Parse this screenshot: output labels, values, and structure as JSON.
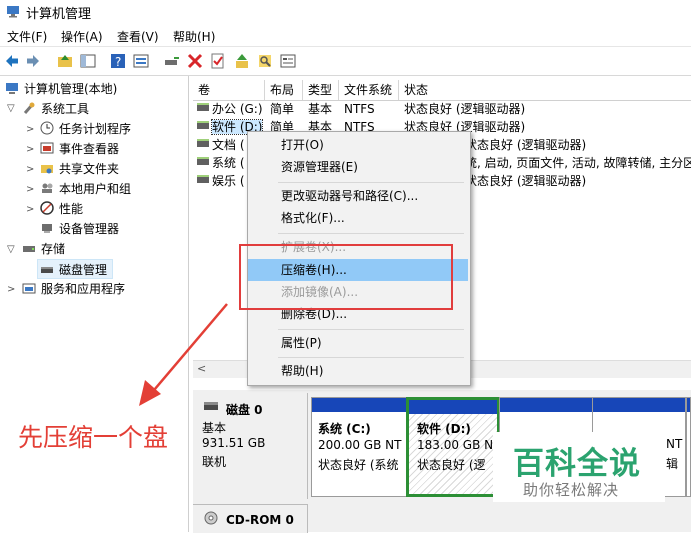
{
  "window": {
    "title": "计算机管理"
  },
  "menu": [
    "文件(F)",
    "操作(A)",
    "查看(V)",
    "帮助(H)"
  ],
  "toolbar": {
    "icons": [
      "back-arrow-icon",
      "forward-arrow-icon",
      "folder-up-icon",
      "show-hide-tree-icon",
      "help-icon",
      "properties-view-icon",
      "connect-drive-icon",
      "delete-icon",
      "check-properties-icon",
      "import-icon",
      "search-icon",
      "console-icon"
    ],
    "colors": {
      "delete": "#d8262a",
      "accent": "#1e73be"
    }
  },
  "tree": {
    "root": "计算机管理(本地)",
    "system_tools": "系统工具",
    "task_scheduler": "任务计划程序",
    "event_viewer": "事件查看器",
    "shared_folders": "共享文件夹",
    "local_users": "本地用户和组",
    "performance": "性能",
    "device_manager": "设备管理器",
    "storage": "存储",
    "disk_management": "磁盘管理",
    "services": "服务和应用程序"
  },
  "volumes": {
    "headers": [
      "卷",
      "布局",
      "类型",
      "文件系统",
      "状态"
    ],
    "rows": [
      {
        "name": "办公 (G:)",
        "layout": "简单",
        "type": "基本",
        "fs": "NTFS",
        "status": "状态良好 (逻辑驱动器)"
      },
      {
        "name": "软件 (D:)",
        "layout": "简单",
        "type": "基本",
        "fs": "NTFS",
        "status": "状态良好 (逻辑驱动器)"
      },
      {
        "name": "文档 (",
        "status": "状态良好 (逻辑驱动器)"
      },
      {
        "name": "系统 (",
        "status": "统, 启动, 页面文件, 活动, 故障转储, 主分区"
      },
      {
        "name": "娱乐 (",
        "status": "状态良好 (逻辑驱动器)"
      }
    ]
  },
  "context_menu": {
    "open": "打开(O)",
    "explorer": "资源管理器(E)",
    "change_letter": "更改驱动器号和路径(C)...",
    "format": "格式化(F)...",
    "extend": "扩展卷(X)...",
    "shrink": "压缩卷(H)...",
    "mirror": "添加镜像(A)...",
    "delete": "删除卷(D)...",
    "properties": "属性(P)",
    "help": "帮助(H)"
  },
  "disks": {
    "disk0": {
      "name": "磁盘 0",
      "kind": "基本",
      "size": "931.51 GB",
      "state": "联机"
    },
    "cdrom": {
      "name": "CD-ROM 0"
    },
    "partitions": [
      {
        "title": "系统  (C:)",
        "size": "200.00 GB NT",
        "status": "状态良好 (系统"
      },
      {
        "title": "软件  (D:)",
        "size": "183.00 GB N",
        "status": "状态良好 (逻"
      },
      {
        "title": "",
        "size": "",
        "status": ""
      },
      {
        "title": "",
        "size": "",
        "status": ""
      },
      {
        "title": "",
        "size": "NT",
        "status": "辑"
      }
    ]
  },
  "annotation": {
    "text": "先压缩一个盘",
    "color": "#e33f36"
  },
  "watermark": {
    "title": "百科全说",
    "subtitle": "助你轻松解决",
    "color": "#2ba36f"
  }
}
